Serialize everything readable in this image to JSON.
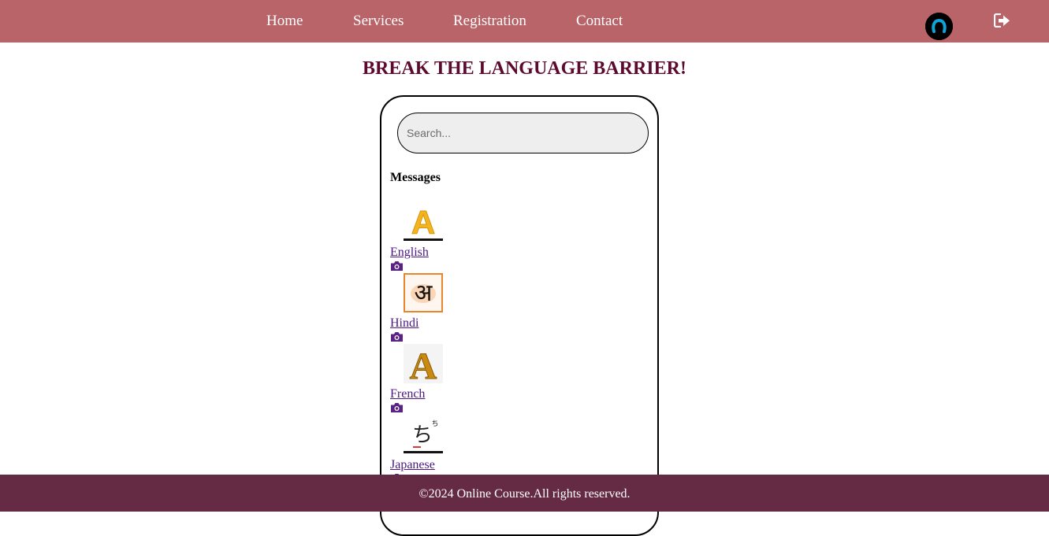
{
  "nav": {
    "links": [
      {
        "label": "Home"
      },
      {
        "label": "Services"
      },
      {
        "label": "Registration"
      },
      {
        "label": "Contact"
      }
    ]
  },
  "page": {
    "title": "BREAK THE LANGUAGE BARRIER!"
  },
  "chat": {
    "search_placeholder": "Search...",
    "messages_heading": "Messages",
    "languages": [
      {
        "name": "English",
        "glyph": "A"
      },
      {
        "name": "Hindi",
        "glyph": "अ"
      },
      {
        "name": "French",
        "glyph": "A"
      },
      {
        "name": "Japanese",
        "glyph": "ち"
      }
    ]
  },
  "footer": {
    "text": "©2024 Online Course.All rights reserved."
  },
  "colors": {
    "navbar": "#b96469",
    "title": "#5c0a2e",
    "link": "#4b1780",
    "footer": "#652a44",
    "avatar_ring": "#0fa3d8"
  },
  "icons": [
    "avatar-icon",
    "logout-icon",
    "camera-icon"
  ]
}
